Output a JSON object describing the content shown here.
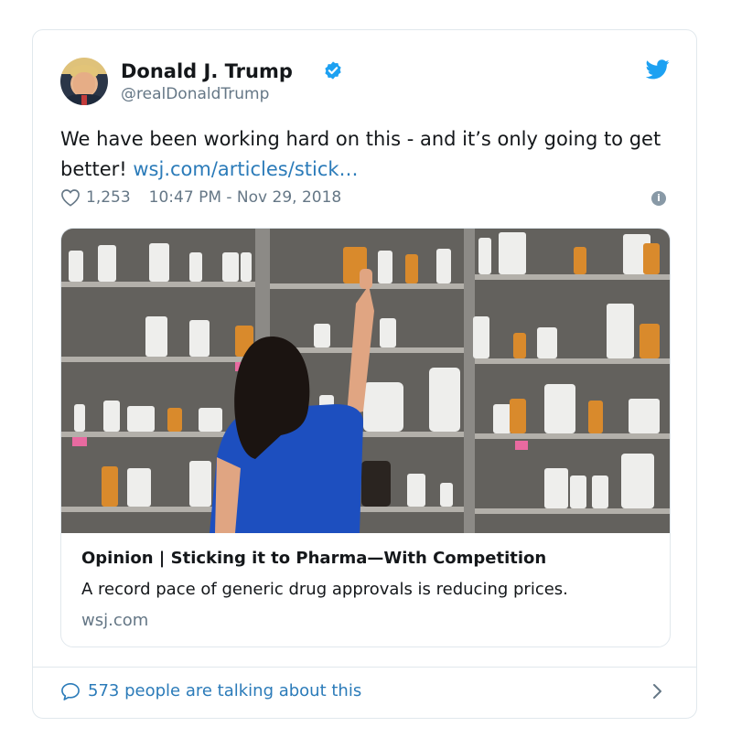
{
  "tweet": {
    "author_name": "Donald J. Trump",
    "handle": "@realDonaldTrump",
    "text_prefix": "We have been working hard on this - and it’s only going to get better! ",
    "link_text": "wsj.com/articles/stick…",
    "likes": "1,253",
    "timestamp": "10:47 PM - Nov 29, 2018",
    "icons": {
      "verified": "verified-badge-icon",
      "logo": "twitter-bird-icon",
      "like": "heart-icon",
      "info": "info-icon"
    }
  },
  "link_card": {
    "title": "Opinion | Sticking it to Pharma—With Competition",
    "description": "A record pace of generic drug approvals is reducing prices.",
    "domain": "wsj.com"
  },
  "footer": {
    "talking_text": "573 people are talking about this",
    "icons": {
      "comment": "speech-bubble-icon",
      "chevron": "chevron-right-icon"
    }
  },
  "colors": {
    "link": "#2b7bb9",
    "secondary_text": "#657786",
    "twitter_blue": "#1da1f2",
    "border": "#e1e8ed"
  }
}
